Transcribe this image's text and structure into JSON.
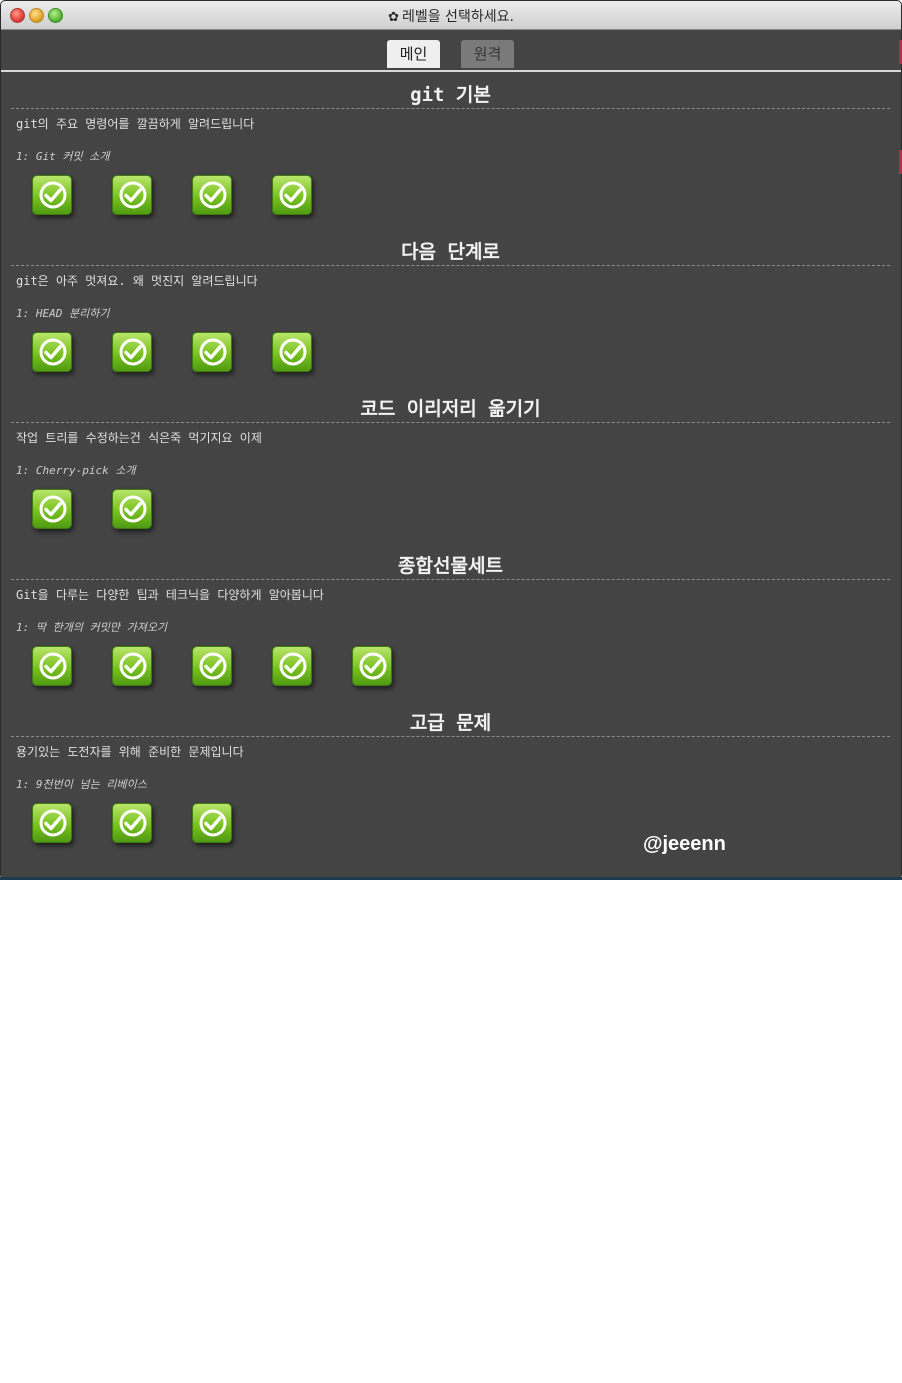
{
  "window": {
    "title": "레벨을 선택하세요.",
    "title_icon": "gear-icon"
  },
  "tabs": [
    {
      "label": "메인",
      "active": true
    },
    {
      "label": "원격",
      "active": false
    }
  ],
  "sections": [
    {
      "title": "git 기본",
      "description": "git의 주요 명령어를 깔끔하게 알려드립니다",
      "first_level": "1: Git 커밋 소개",
      "levels_completed": 4
    },
    {
      "title": "다음 단계로",
      "description": "git은 아주 멋져요. 왜 멋진지 알려드립니다",
      "first_level": "1: HEAD 분리하기",
      "levels_completed": 4
    },
    {
      "title": "코드 이리저리 옮기기",
      "description": "작업 트리를 수정하는건 식은죽 먹기지요 이제",
      "first_level": "1: Cherry-pick 소개",
      "levels_completed": 2
    },
    {
      "title": "종합선물세트",
      "description": "Git을 다루는 다양한 팁과 테크닉을 다양하게 알아봅니다",
      "first_level": "1: 딱 한개의 커밋만 가져오기",
      "levels_completed": 5
    },
    {
      "title": "고급 문제",
      "description": "용기있는 도전자를 위해 준비한 문제입니다",
      "first_level": "1: 9천번이 넘는 리베이스",
      "levels_completed": 3
    }
  ],
  "level_icon": "check-icon",
  "colors": {
    "window_bg": "#444444",
    "level_green": "#79c220",
    "title_text": "#f2f2f2"
  },
  "watermark": "@jeeenn"
}
